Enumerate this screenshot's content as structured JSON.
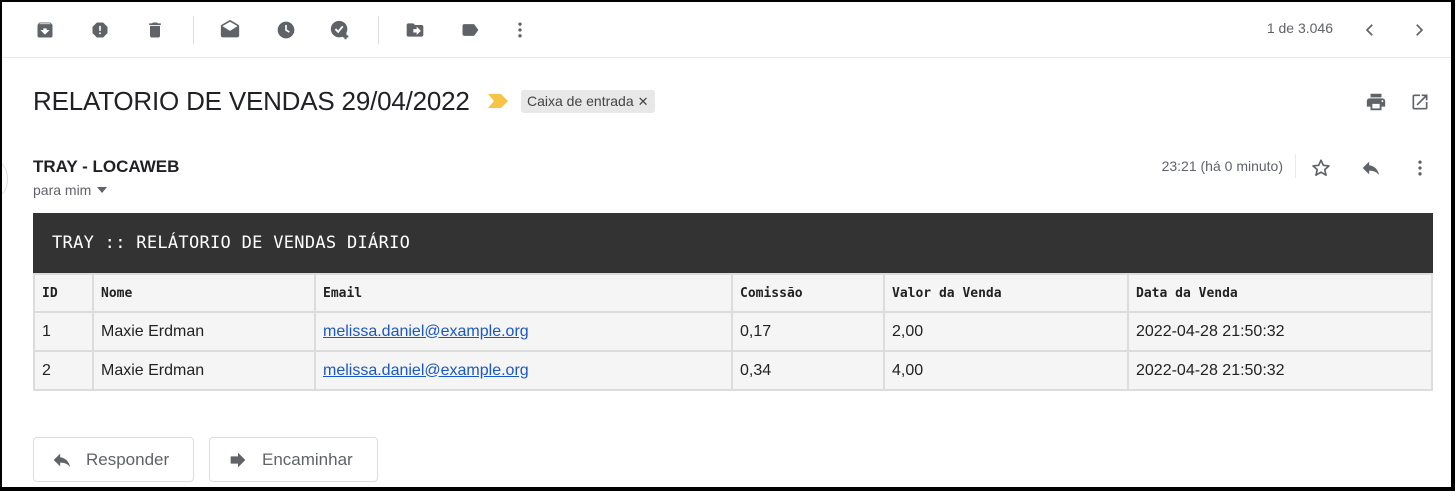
{
  "toolbar": {
    "icons": [
      "archive-icon",
      "report-spam-icon",
      "delete-icon",
      "mark-unread-icon",
      "snooze-icon",
      "add-task-icon",
      "move-to-icon",
      "label-icon",
      "more-vert-icon"
    ],
    "counter": "1 de 3.046"
  },
  "message": {
    "subject": "RELATORIO DE VENDAS 29/04/2022",
    "label": "Caixa de entrada",
    "sender": "TRAY - LOCAWEB",
    "recipient": "para mim",
    "time": "23:21 (há 0 minuto)"
  },
  "report": {
    "title": "TRAY :: RELÁTORIO DE VENDAS DIÁRIO",
    "columns": [
      "ID",
      "Nome",
      "Email",
      "Comissão",
      "Valor da Venda",
      "Data da Venda"
    ],
    "rows": [
      [
        "1",
        "Maxie Erdman",
        "melissa.daniel@example.org",
        "0,17",
        "2,00",
        "2022-04-28 21:50:32"
      ],
      [
        "2",
        "Maxie Erdman",
        "melissa.daniel@example.org",
        "0,34",
        "4,00",
        "2022-04-28 21:50:32"
      ]
    ]
  },
  "actions": {
    "reply": "Responder",
    "forward": "Encaminhar"
  },
  "colors": {
    "report_header_bg": "#333333",
    "link": "#1a57c6",
    "important_marker": "#f6c344"
  }
}
